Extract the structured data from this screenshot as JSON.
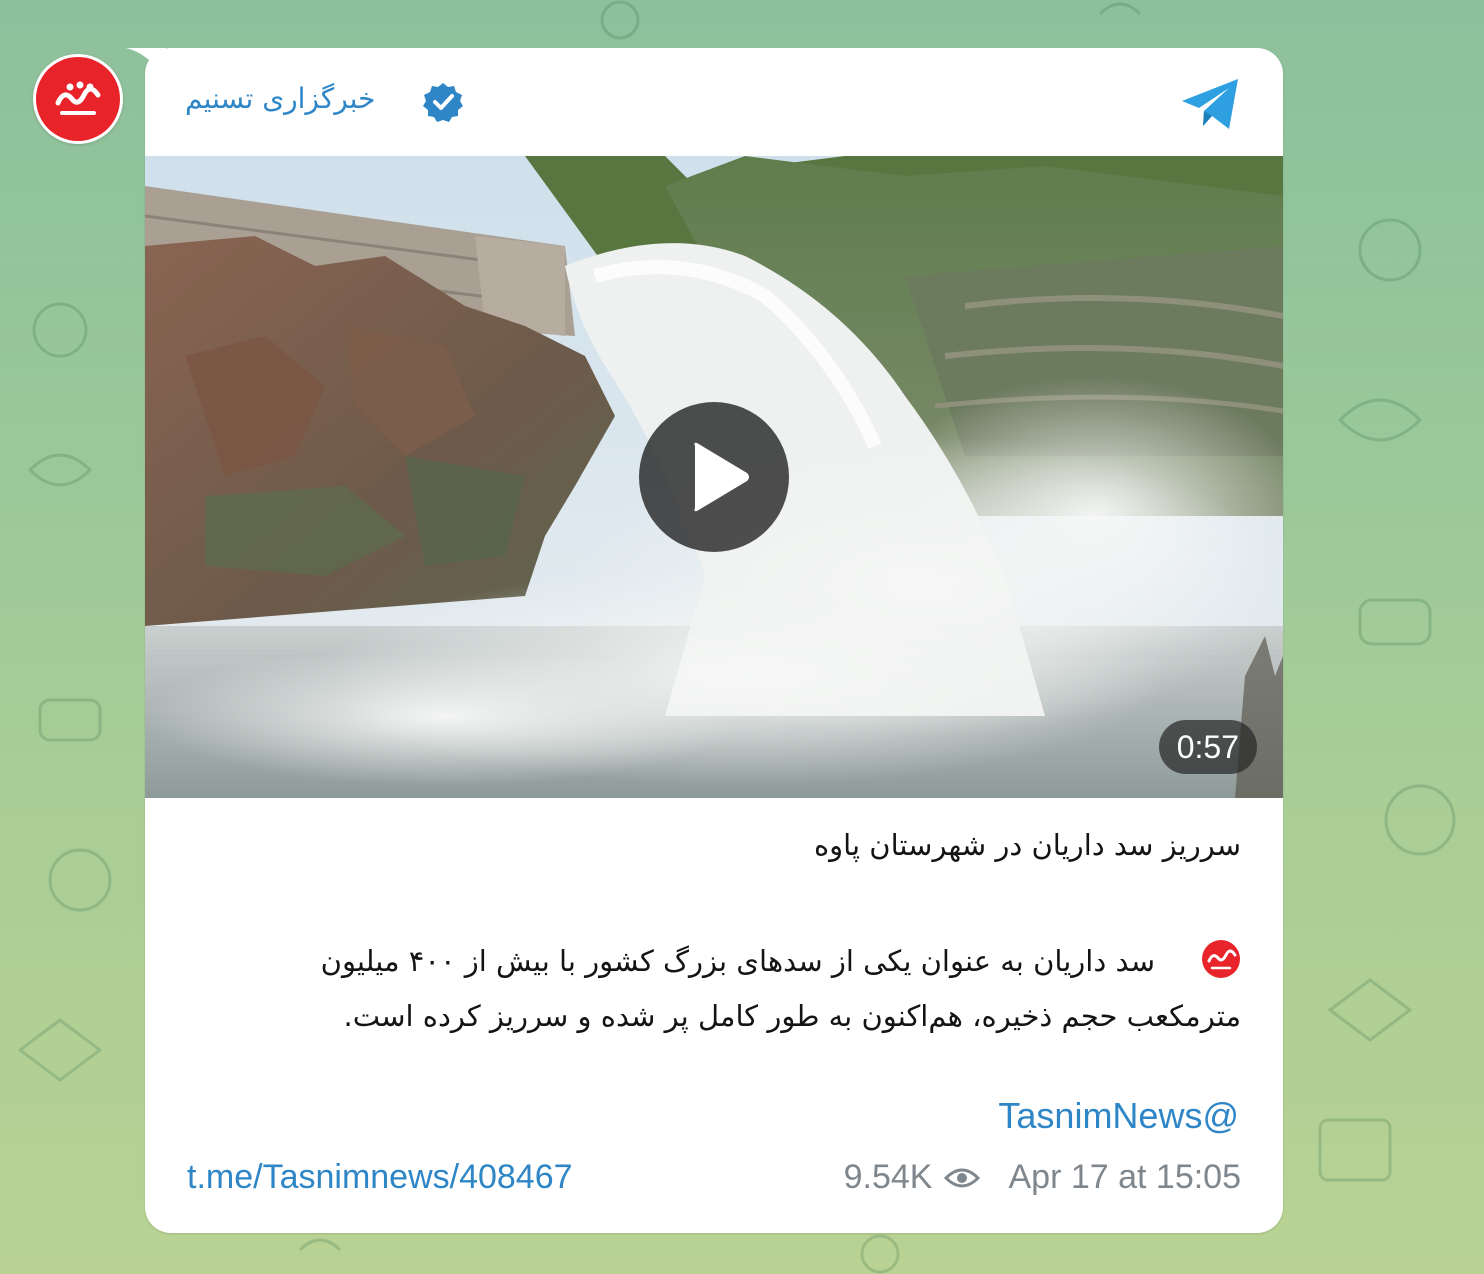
{
  "channel": {
    "name": "خبرگزاری تسنیم",
    "avatar_icon": "tasnim-logo-icon",
    "verified_icon": "verified-badge-icon",
    "app_icon": "telegram-icon"
  },
  "video": {
    "duration": "0:57",
    "play_icon": "play-icon"
  },
  "caption": {
    "title": "سرریز سد داریان در شهرستان پاوه",
    "body": "سد داریان به عنوان یکی از سدهای بزرگ کشور با بیش از ۴۰۰ میلیون مترمکعب حجم ذخیره، هم‌اکنون به طور کامل پر شده و سرریز کرده است.",
    "handle": "TasnimNews@"
  },
  "footer": {
    "link": "t.me/Tasnimnews/408467",
    "views": "9.54K",
    "views_icon": "eye-icon",
    "timestamp": "Apr 17 at 15:05"
  },
  "colors": {
    "accent": "#2e86c7",
    "logo_red": "#e8232a",
    "meta_gray": "#7f878e"
  }
}
